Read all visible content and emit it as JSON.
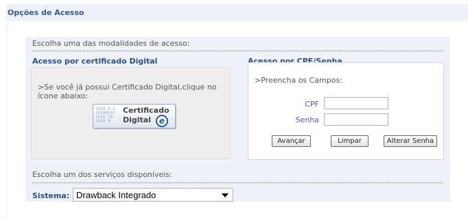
{
  "header": {
    "title": "Opções de Acesso"
  },
  "panel": {
    "intro": "Escolha uma das modalidades de acesso:",
    "certificate": {
      "title": "Acesso por certificado Digital",
      "instruction": ">Se você já possui Certificado Digital,clique no ícone abaixo:",
      "button_line1": "Certificado",
      "button_line2": "Digital",
      "button_binary": "1010 0 1\n10100101\n1010 10\n1010 0"
    },
    "cpf": {
      "title": "Acesso por CPF/Senha",
      "instruction": ">Preencha os Campos:",
      "cpf_label": "CPF",
      "cpf_value": "",
      "senha_label": "Senha",
      "senha_value": "",
      "buttons": {
        "advance": "Avançar",
        "clear": "Limpar",
        "change_password": "Alterar Senha"
      }
    },
    "services": {
      "label": "Escolha um dos serviços disponíveis:",
      "system_label": "Sistema:",
      "system_value": "Drawback Integrado"
    }
  }
}
